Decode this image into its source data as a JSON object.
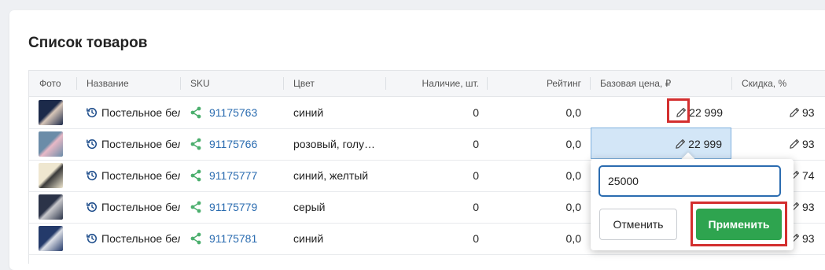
{
  "page": {
    "title": "Список товаров"
  },
  "columns": {
    "photo": "Фото",
    "name": "Название",
    "sku": "SKU",
    "color": "Цвет",
    "stock": "Наличие, шт.",
    "rating": "Рейтинг",
    "base_price": "Базовая цена, ₽",
    "discount": "Скидка, %"
  },
  "rows": [
    {
      "name": "Постельное бел",
      "sku": "91175763",
      "color": "синий",
      "stock": "0",
      "rating": "0,0",
      "price": "22 999",
      "discount": "93"
    },
    {
      "name": "Постельное бел",
      "sku": "91175766",
      "color": "розовый, голу…",
      "stock": "0",
      "rating": "0,0",
      "price": "22 999",
      "discount": "93"
    },
    {
      "name": "Постельное бел",
      "sku": "91175777",
      "color": "синий, желтый",
      "stock": "0",
      "rating": "0,0",
      "price": "",
      "discount": "74"
    },
    {
      "name": "Постельное бел",
      "sku": "91175779",
      "color": "серый",
      "stock": "0",
      "rating": "0,0",
      "price": "",
      "discount": "93"
    },
    {
      "name": "Постельное бел",
      "sku": "91175781",
      "color": "синий",
      "stock": "0",
      "rating": "0,0",
      "price": "",
      "discount": "93"
    }
  ],
  "popup": {
    "input_value": "25000",
    "cancel_label": "Отменить",
    "apply_label": "Применить"
  },
  "colors": {
    "accent_link": "#2b6cb0",
    "apply_green": "#2ea44f",
    "highlight_red": "#d32f2f",
    "active_cell": "#d3e6f7"
  },
  "icons": [
    "history-icon",
    "share-icon",
    "pencil-icon"
  ]
}
